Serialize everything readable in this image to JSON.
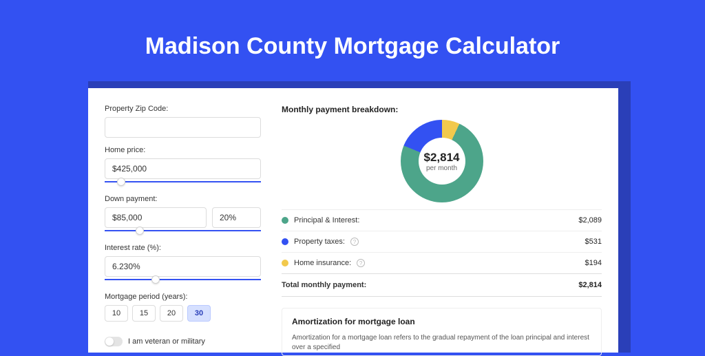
{
  "page_title": "Madison County Mortgage Calculator",
  "form": {
    "zip": {
      "label": "Property Zip Code:",
      "value": ""
    },
    "home_price": {
      "label": "Home price:",
      "value": "$425,000",
      "slider_pct": 8
    },
    "down_payment": {
      "label": "Down payment:",
      "amount": "$85,000",
      "percent": "20%",
      "slider_pct": 20
    },
    "interest_rate": {
      "label": "Interest rate (%):",
      "value": "6.230%",
      "slider_pct": 30
    },
    "period": {
      "label": "Mortgage period (years):",
      "options": [
        "10",
        "15",
        "20",
        "30"
      ],
      "selected": "30"
    },
    "veteran": {
      "label": "I am veteran or military"
    }
  },
  "breakdown": {
    "title": "Monthly payment breakdown:",
    "center_amount": "$2,814",
    "center_sub": "per month",
    "items": [
      {
        "swatch": "green",
        "label": "Principal & Interest:",
        "help": false,
        "value": "$2,089"
      },
      {
        "swatch": "blue",
        "label": "Property taxes:",
        "help": true,
        "value": "$531"
      },
      {
        "swatch": "yellow",
        "label": "Home insurance:",
        "help": true,
        "value": "$194"
      }
    ],
    "total": {
      "label": "Total monthly payment:",
      "value": "$2,814"
    }
  },
  "amortization": {
    "title": "Amortization for mortgage loan",
    "text": "Amortization for a mortgage loan refers to the gradual repayment of the loan principal and interest over a specified"
  },
  "chart_data": {
    "type": "pie",
    "title": "Monthly payment breakdown",
    "series": [
      {
        "name": "Principal & Interest",
        "value": 2089,
        "color": "#4da58a"
      },
      {
        "name": "Property taxes",
        "value": 531,
        "color": "#3351f2"
      },
      {
        "name": "Home insurance",
        "value": 194,
        "color": "#f2c94c"
      }
    ],
    "total": 2814,
    "center_label": "$2,814 per month"
  }
}
